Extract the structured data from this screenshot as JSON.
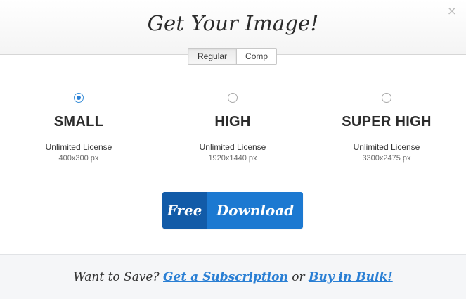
{
  "dialog": {
    "title": "Get Your Image!",
    "close_glyph": "×"
  },
  "tabs": [
    {
      "label": "Regular",
      "active": true
    },
    {
      "label": "Comp",
      "active": false
    }
  ],
  "options": [
    {
      "name": "SMALL",
      "license": "Unlimited License",
      "dimensions": "400x300 px",
      "selected": true
    },
    {
      "name": "HIGH",
      "license": "Unlimited License",
      "dimensions": "1920x1440 px",
      "selected": false
    },
    {
      "name": "SUPER HIGH",
      "license": "Unlimited License",
      "dimensions": "3300x2475 px",
      "selected": false
    }
  ],
  "download": {
    "free_label": "Free",
    "action_label": "Download"
  },
  "footer": {
    "prefix": "Want to Save?",
    "subscription_link": "Get a Subscription",
    "conjunction": "or",
    "bulk_link": "Buy in Bulk!"
  },
  "colors": {
    "accent_blue": "#1c79d1",
    "accent_dark_blue": "#125ba8",
    "link_blue": "#2a7fd4"
  }
}
